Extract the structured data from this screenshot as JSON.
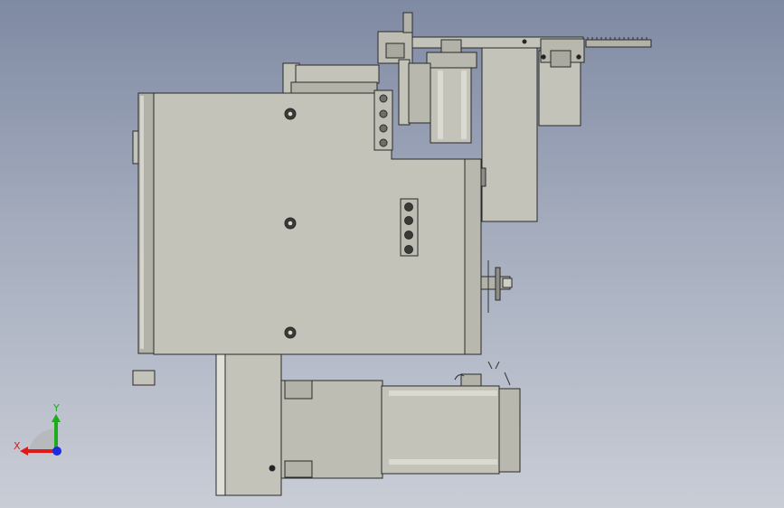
{
  "viewport": {
    "background_top": "#7f8aa3",
    "background_bottom": "#c9cdd6",
    "part_fill": "#c3c3b9",
    "part_fill_dark": "#b2b2a8",
    "edge_color": "#2a2a2a"
  },
  "triad": {
    "x_label": "X",
    "y_label": "Y",
    "x_color": "#e01919",
    "y_color": "#1faa1f",
    "z_color": "#1c2ce0",
    "icon": "coordinate-triad-icon"
  }
}
